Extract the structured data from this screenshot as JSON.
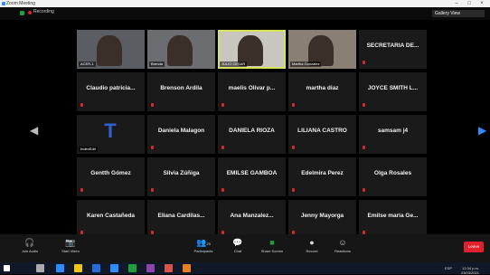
{
  "window": {
    "title": "Zoom Meeting",
    "controls": [
      "–",
      "□",
      "×"
    ]
  },
  "topbar": {
    "recording": "Recording",
    "view_button": "Gallery View"
  },
  "participants": [
    {
      "name": "ACER-1",
      "video": true
    },
    {
      "name": "Brenda",
      "video": true
    },
    {
      "name": "JULIO CESAR",
      "video": true,
      "active": true
    },
    {
      "name": "Martha Gonzalez",
      "video": true
    },
    {
      "name": "SECRETARIA DE...",
      "video": false
    },
    {
      "name": "Claudio  patricia...",
      "video": false
    },
    {
      "name": "Brenson Ardila",
      "video": false
    },
    {
      "name": "maelis Olivar p...",
      "video": false
    },
    {
      "name": "martha diaz",
      "video": false
    },
    {
      "name": "JOYCE SMITH L...",
      "video": false
    },
    {
      "name": "IndexEdit",
      "video": false,
      "logo": true
    },
    {
      "name": "Daniela Malagon",
      "video": false
    },
    {
      "name": "DANIELA RIOZA",
      "video": false
    },
    {
      "name": "LILIANA CASTRO",
      "video": false
    },
    {
      "name": "samsam j4",
      "video": false
    },
    {
      "name": "Gentth Gómez",
      "video": false
    },
    {
      "name": "Silvia Zúñiga",
      "video": false
    },
    {
      "name": "EMILSE GAMBOA",
      "video": false
    },
    {
      "name": "Edelmira Perez",
      "video": false
    },
    {
      "name": "Olga Rosales",
      "video": false
    },
    {
      "name": "Karen Castañeda",
      "video": false
    },
    {
      "name": "Eliana  Cardilas...",
      "video": false
    },
    {
      "name": "Ana  Manzalez...",
      "video": false
    },
    {
      "name": "Jenny Mayorga",
      "video": false
    },
    {
      "name": "Emilse maria Ge...",
      "video": false
    }
  ],
  "toolbar": {
    "join_audio": "Join Audio",
    "start_video": "Start Video",
    "participants": "Participants",
    "participants_count": "25",
    "chat": "Chat",
    "share_screen": "Share Screen",
    "record": "Record",
    "reactions": "Reactions",
    "leave": "Leave"
  },
  "taskbar": {
    "time": "12:34 p.m.",
    "date": "23/03/2021",
    "lang": "ESP"
  },
  "colors": {
    "accent_green": "#1f9e3c",
    "end_red": "#e0202a",
    "arrow_blue": "#2d8cff",
    "active_border": "#d7e25a"
  }
}
